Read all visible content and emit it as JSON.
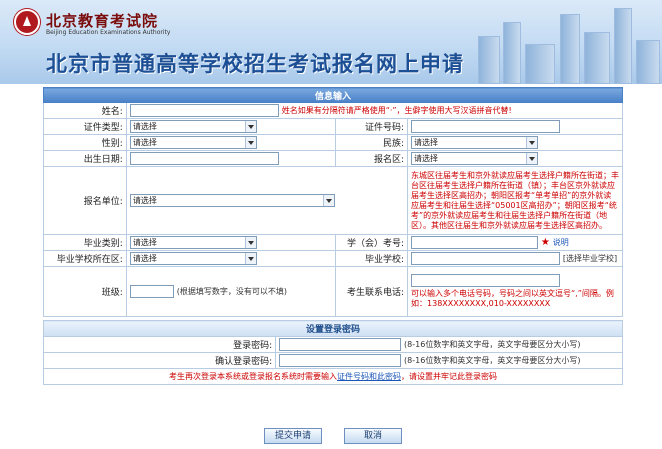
{
  "header": {
    "org_cn": "北京教育考试院",
    "org_en": "Beijing Education Examinations Authority",
    "title": "北京市普通高等学校招生考试报名网上申请"
  },
  "sections": {
    "info": "信息输入",
    "login": "设置登录密码"
  },
  "fields": {
    "name_label": "姓名:",
    "name_hint": "姓名如果有分隔符请严格使用“·”，生僻字使用大写汉语拼音代替!",
    "id_type_label": "证件类型:",
    "id_type_value": "请选择",
    "id_number_label": "证件号码:",
    "gender_label": "性别:",
    "gender_value": "请选择",
    "ethnic_label": "民族:",
    "ethnic_value": "请选择",
    "birth_label": "出生日期:",
    "district_label": "报名区:",
    "district_value": "请选择",
    "unit_label": "报名单位:",
    "unit_value": "请选择",
    "unit_hint": "东城区往届考生和京外就读应届考生选择户籍所在街道；丰台区往届考生选择户籍所在街道（镇）；丰台区京外就读应届考生选择区高招办；朝阳区报考“单考单招”的京外就读应届考生和往届生选择“05001区高招办”；朝阳区报考“统考”的京外就读应届考生和往届生选择户籍所在街道（地区）。其他区往届生和京外就读应届考生选择区高招办。",
    "grad_type_label": "毕业类别:",
    "grad_type_value": "请选择",
    "student_no_label": "学（会）考号:",
    "star": "★",
    "explain_link": "说明",
    "school_district_label": "毕业学校所在区:",
    "school_district_value": "请选择",
    "school_label": "毕业学校:",
    "school_select": "[选择毕业学校]",
    "class_label": "班级:",
    "class_hint": "(根据填写数字，没有可以不填)",
    "phone_label": "考生联系电话:",
    "phone_hint": "可以输入多个电话号码，号码之间以英文逗号“,”间隔。例如：138XXXXXXXX,010-XXXXXXXX"
  },
  "login": {
    "pwd_label": "登录密码:",
    "pwd_hint": "(8-16位数字和英文字母，英文字母要区分大小写)",
    "confirm_label": "确认登录密码:",
    "confirm_hint": "(8-16位数字和英文字母，英文字母要区分大小写)",
    "notice_before": "考生再次登录本系统或登录报名系统时需要输入",
    "notice_highlight": "证件号码和此密码",
    "notice_after": "，请设置并牢记此登录密码"
  },
  "buttons": {
    "submit": "提交申请",
    "cancel": "取消"
  }
}
